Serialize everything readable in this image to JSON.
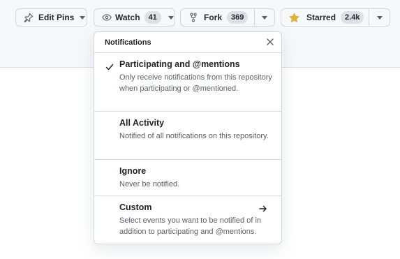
{
  "toolbar": {
    "edit_pins_label": "Edit Pins",
    "watch_label": "Watch",
    "watch_count": "41",
    "fork_label": "Fork",
    "fork_count": "369",
    "starred_label": "Starred",
    "starred_count": "2.4k"
  },
  "popover": {
    "title": "Notifications",
    "items": [
      {
        "title": "Participating and @mentions",
        "description": "Only receive notifications from this repository when participating or @mentioned.",
        "selected": true
      },
      {
        "title": "All Activity",
        "description": "Notified of all notifications on this repository.",
        "selected": false
      },
      {
        "title": "Ignore",
        "description": "Never be notified.",
        "selected": false
      },
      {
        "title": "Custom",
        "description": "Select events you want to be notified of in addition to participating and @mentions.",
        "selected": false,
        "has_arrow": true
      }
    ]
  },
  "icons": {
    "pin": "pin-icon",
    "eye": "eye-icon",
    "fork": "fork-icon",
    "star": "star-icon",
    "caret": "triangle-down-icon",
    "close": "close-icon",
    "check": "check-icon",
    "arrow": "arrow-right-icon"
  },
  "colors": {
    "star_fill": "#e3b341",
    "button_bg": "#f6f8fa",
    "border": "#d0d7de",
    "text_muted": "#57606a"
  }
}
